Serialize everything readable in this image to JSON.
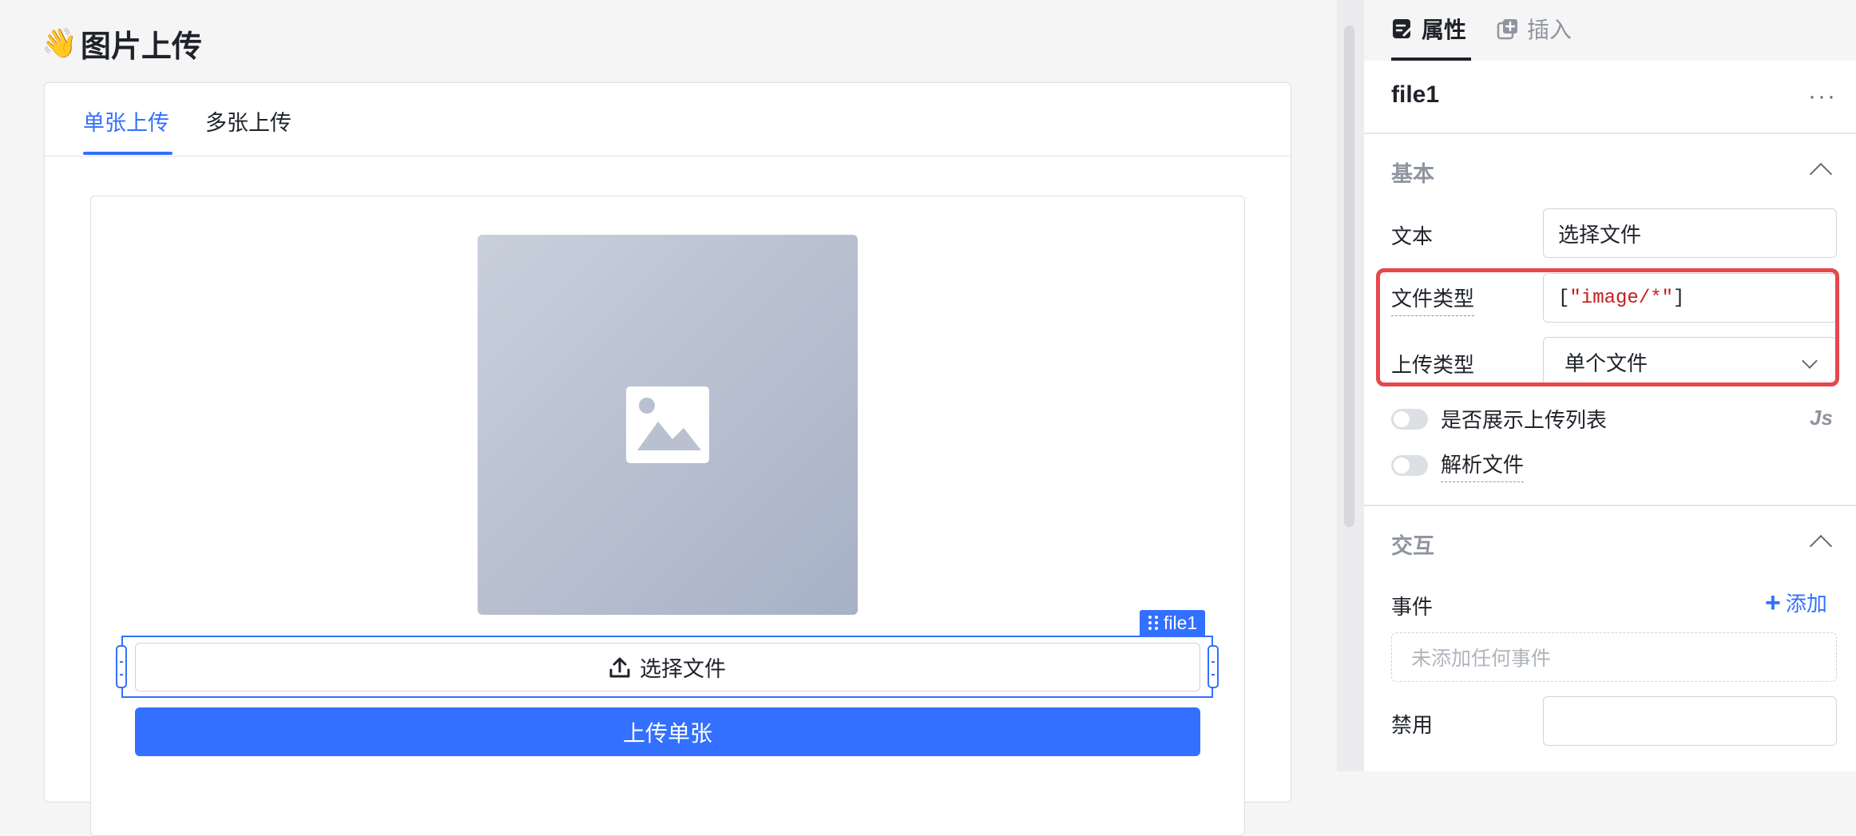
{
  "page": {
    "title_emoji": "👋",
    "title": "图片上传"
  },
  "tabs": [
    {
      "label": "单张上传",
      "active": true
    },
    {
      "label": "多张上传",
      "active": false
    }
  ],
  "canvas": {
    "selected_component": "file1",
    "choose_button_label": "选择文件",
    "upload_button_label": "上传单张",
    "icons": {
      "image_placeholder": "image-icon",
      "upload": "upload-icon",
      "drag": "drag-handle-icon"
    }
  },
  "panel": {
    "tabs": [
      {
        "label": "属性",
        "icon": "properties-icon",
        "active": true
      },
      {
        "label": "插入",
        "icon": "insert-icon",
        "active": false
      }
    ],
    "component_name": "file1",
    "more": "···",
    "basic": {
      "title": "基本",
      "text_label": "文本",
      "text_value": "选择文件",
      "file_type_label": "文件类型",
      "file_type_open": "[",
      "file_type_value": "\"image/*\"",
      "file_type_close": "]",
      "upload_type_label": "上传类型",
      "upload_type_value": "单个文件",
      "show_list_label": "是否展示上传列表",
      "show_list_on": false,
      "parse_file_label": "解析文件",
      "parse_file_on": false,
      "js_badge": "Js"
    },
    "interaction": {
      "title": "交互",
      "events_label": "事件",
      "add_label": "添加",
      "empty_events": "未添加任何事件",
      "disabled_label": "禁用",
      "disabled_value": ""
    }
  },
  "colors": {
    "accent": "#3370ff",
    "highlight": "#e5484d",
    "code_string": "#c41d1d"
  }
}
